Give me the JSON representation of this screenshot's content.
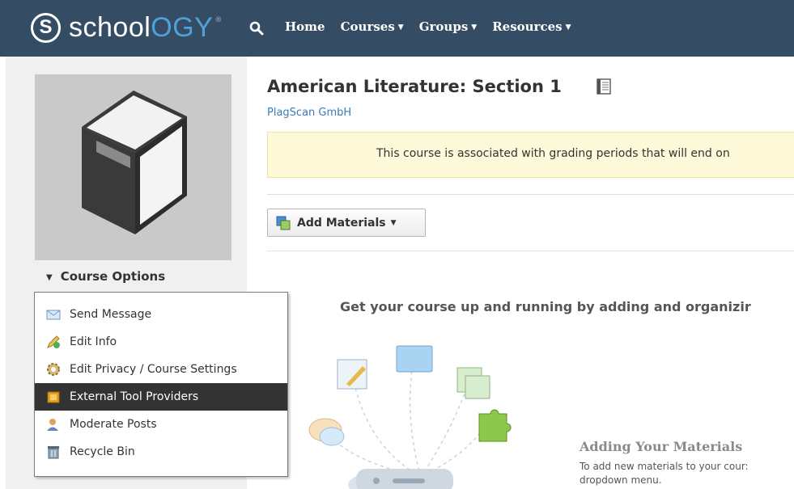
{
  "brand": {
    "logo_letter": "S",
    "name_part1": "school",
    "name_part2": "OGY",
    "trademark": "®"
  },
  "nav": {
    "items": [
      {
        "label": "Home",
        "has_caret": false
      },
      {
        "label": "Courses",
        "has_caret": true
      },
      {
        "label": "Groups",
        "has_caret": true
      },
      {
        "label": "Resources",
        "has_caret": true
      }
    ],
    "caret": "▼"
  },
  "sidebar": {
    "course_options_label": "Course Options",
    "toggle_glyph": "▼",
    "menu": [
      {
        "label": "Send Message",
        "icon": "envelope-icon"
      },
      {
        "label": "Edit Info",
        "icon": "pencil-icon"
      },
      {
        "label": "Edit Privacy / Course Settings",
        "icon": "gear-icon"
      },
      {
        "label": "External Tool Providers",
        "icon": "puzzle-icon",
        "active": true
      },
      {
        "label": "Moderate Posts",
        "icon": "user-icon"
      },
      {
        "label": "Recycle Bin",
        "icon": "recycle-bin-icon"
      }
    ]
  },
  "main": {
    "title": "American Literature: Section 1",
    "subtitle": "PlagScan GmbH",
    "alert": "This course is associated with grading periods that will end on",
    "add_materials_label": "Add Materials",
    "caret": "▼",
    "get_started": "Get your course up and running by adding and organizir",
    "adding_title": "Adding Your Materials",
    "adding_desc_line1": "To add new materials to your cour:",
    "adding_desc_line2": "dropdown menu."
  },
  "colors": {
    "topbar": "#354d64",
    "accent": "#4fa2d9",
    "link": "#3b7bb9",
    "alert_bg": "#fef9d9",
    "menu_active": "#333333"
  }
}
